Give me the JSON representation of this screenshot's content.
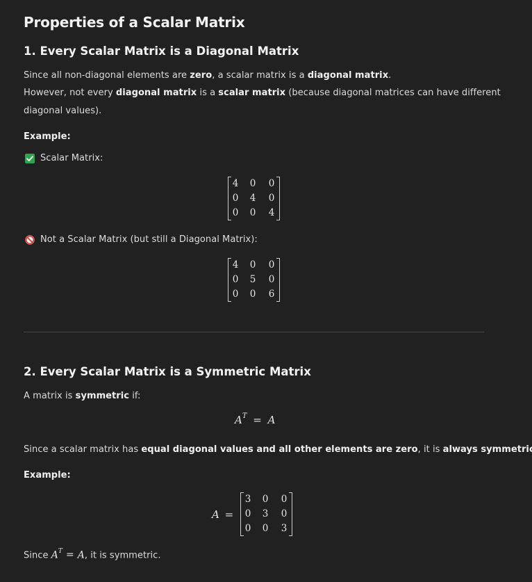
{
  "title": "Properties of a Scalar Matrix",
  "section1": {
    "heading": "1. Every Scalar Matrix is a Diagonal Matrix",
    "line1_pre": "Since all non-diagonal elements are ",
    "line1_b1": "zero",
    "line1_mid": ", a scalar matrix is a ",
    "line1_b2": "diagonal matrix",
    "line1_post": ".",
    "line2_pre": "However, not every ",
    "line2_b1": "diagonal matrix",
    "line2_mid": " is a ",
    "line2_b2": "scalar matrix",
    "line2_post": " (because diagonal matrices can have different",
    "line3": "diagonal values).",
    "example_label": "Example:",
    "scalar_label": "Scalar Matrix:",
    "scalar_matrix": [
      [
        "4",
        "0",
        "0"
      ],
      [
        "0",
        "4",
        "0"
      ],
      [
        "0",
        "0",
        "4"
      ]
    ],
    "not_scalar_label": "Not a Scalar Matrix (but still a Diagonal Matrix):",
    "diag_matrix": [
      [
        "4",
        "0",
        "0"
      ],
      [
        "0",
        "5",
        "0"
      ],
      [
        "0",
        "0",
        "6"
      ]
    ]
  },
  "section2": {
    "heading": "2. Every Scalar Matrix is a Symmetric Matrix",
    "def_pre": "A matrix is ",
    "def_b": "symmetric",
    "def_post": " if:",
    "eq_lhs": "A",
    "eq_sup": "T",
    "eq_op": "=",
    "eq_rhs": "A",
    "since_pre": "Since a scalar matrix has ",
    "since_b1": "equal diagonal values and all other elements are zero",
    "since_mid": ", it is ",
    "since_b2": "always symmetric",
    "since_post": ".",
    "example_label": "Example:",
    "matrix_lhs": "A",
    "matrix_eq": "=",
    "matrix": [
      [
        "3",
        "0",
        "0"
      ],
      [
        "0",
        "3",
        "0"
      ],
      [
        "0",
        "0",
        "3"
      ]
    ],
    "final_pre": "Since ",
    "final_A": "A",
    "final_sup": "T",
    "final_eq": "=",
    "final_A2": "A",
    "final_post": ", it is symmetric."
  },
  "icons": {
    "check": "check-icon",
    "prohibited": "prohibited-icon"
  },
  "colors": {
    "background": "#212121",
    "check_green": "#2ea44f",
    "prohibited_red": "#e0443a"
  }
}
